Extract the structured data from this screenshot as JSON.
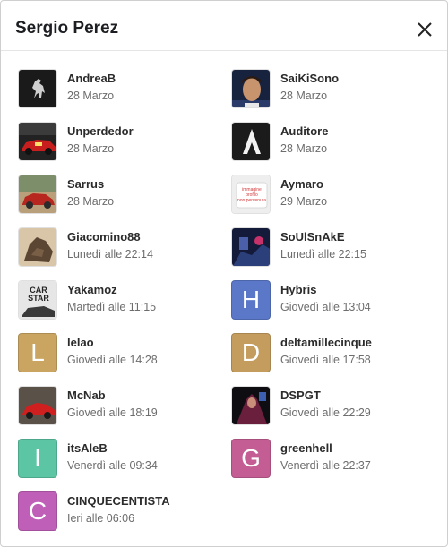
{
  "modal": {
    "title": "Sergio Perez"
  },
  "items": [
    {
      "name": "AndreaB",
      "date": "28 Marzo",
      "avatar": "ferrari-horse-photo"
    },
    {
      "name": "SaiKiSono",
      "date": "28 Marzo",
      "avatar": "portrait-photo"
    },
    {
      "name": "Unperdedor",
      "date": "28 Marzo",
      "avatar": "red-race-car-photo"
    },
    {
      "name": "Auditore",
      "date": "28 Marzo",
      "avatar": "assassin-logo"
    },
    {
      "name": "Sarrus",
      "date": "28 Marzo",
      "avatar": "vintage-car-photo"
    },
    {
      "name": "Aymaro",
      "date": "29 Marzo",
      "avatar": "placeholder-image"
    },
    {
      "name": "Giacomino88",
      "date": "Lunedì alle 22:14",
      "avatar": "brown-object-photo"
    },
    {
      "name": "SoUlSnAkE",
      "date": "Lunedì alle 22:15",
      "avatar": "game-art-photo"
    },
    {
      "name": "Yakamoz",
      "date": "Martedì alle 11:15",
      "avatar": "car-star-magazine"
    },
    {
      "name": "Hybris",
      "date": "Giovedì alle 13:04",
      "letter": "H",
      "color": "#5a78c7"
    },
    {
      "name": "lelao",
      "date": "Giovedì alle 14:28",
      "letter": "L",
      "color": "#c9a561"
    },
    {
      "name": "deltamillecinque",
      "date": "Giovedì alle 17:58",
      "letter": "D",
      "color": "#c49d5e"
    },
    {
      "name": "McNab",
      "date": "Giovedì alle 18:19",
      "avatar": "red-car-photo"
    },
    {
      "name": "DSPGT",
      "date": "Giovedì alle 22:29",
      "avatar": "dark-poster-photo"
    },
    {
      "name": "itsAleB",
      "date": "Venerdì alle 09:34",
      "letter": "I",
      "color": "#5bc5a4"
    },
    {
      "name": "greenhell",
      "date": "Venerdì alle 22:37",
      "letter": "G",
      "color": "#c45d93"
    },
    {
      "name": "CINQUECENTISTA",
      "date": "Ieri alle 06:06",
      "letter": "C",
      "color": "#bf5fb8"
    }
  ],
  "placeholder_text": [
    "immagine",
    "profilo",
    "non pervenuta"
  ],
  "magazine_text": [
    "CAR",
    "STAR"
  ]
}
